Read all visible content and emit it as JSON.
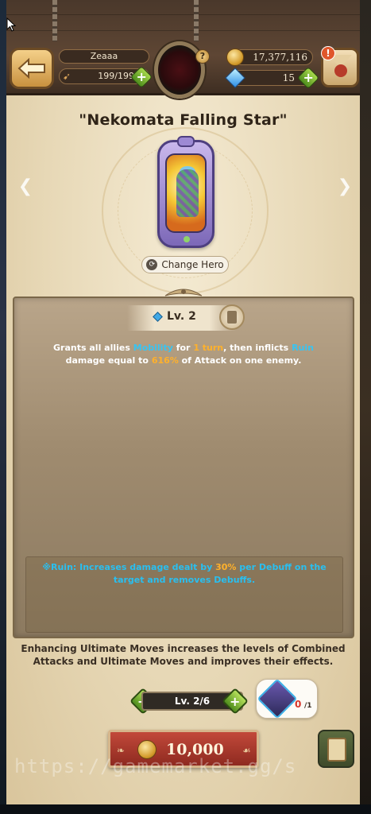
{
  "header": {
    "player_name": "Zeaaa",
    "stamina": "199/199",
    "gold": "17,377,116",
    "gems": "15",
    "alert": "!"
  },
  "title": "\"Nekomata Falling Star\"",
  "change_hero_label": "Change Hero",
  "skill": {
    "level": "Lv. 2",
    "desc": {
      "p1": "Grants all allies ",
      "k1": "Mobility",
      "p2": " for ",
      "k2": "1 turn",
      "p3": ", then inflicts ",
      "k3": "Ruin",
      "p4": " damage equal to ",
      "k4": "616%",
      "p5": " of Attack on one enemy."
    },
    "note": {
      "p1": "※Ruin: Increases damage dealt by ",
      "k1": "30%",
      "p2": " per Debuff on the target and removes Debuffs."
    }
  },
  "info_text": "Enhancing Ultimate Moves increases the levels of Combined Attacks and Ultimate Moves and improves their effects.",
  "stepper": {
    "label": "Lv. 2/6",
    "minus": "−",
    "plus": "+"
  },
  "material": {
    "count": "0",
    "needed": "/1"
  },
  "enhance_cost": "10,000",
  "watermark": "https://gamemarket.gg/s",
  "colors": {
    "keyword_blue": "#38c4f2",
    "keyword_orange": "#ffb12b",
    "button_red": "#b23f31",
    "plus_green": "#6fae2e"
  }
}
